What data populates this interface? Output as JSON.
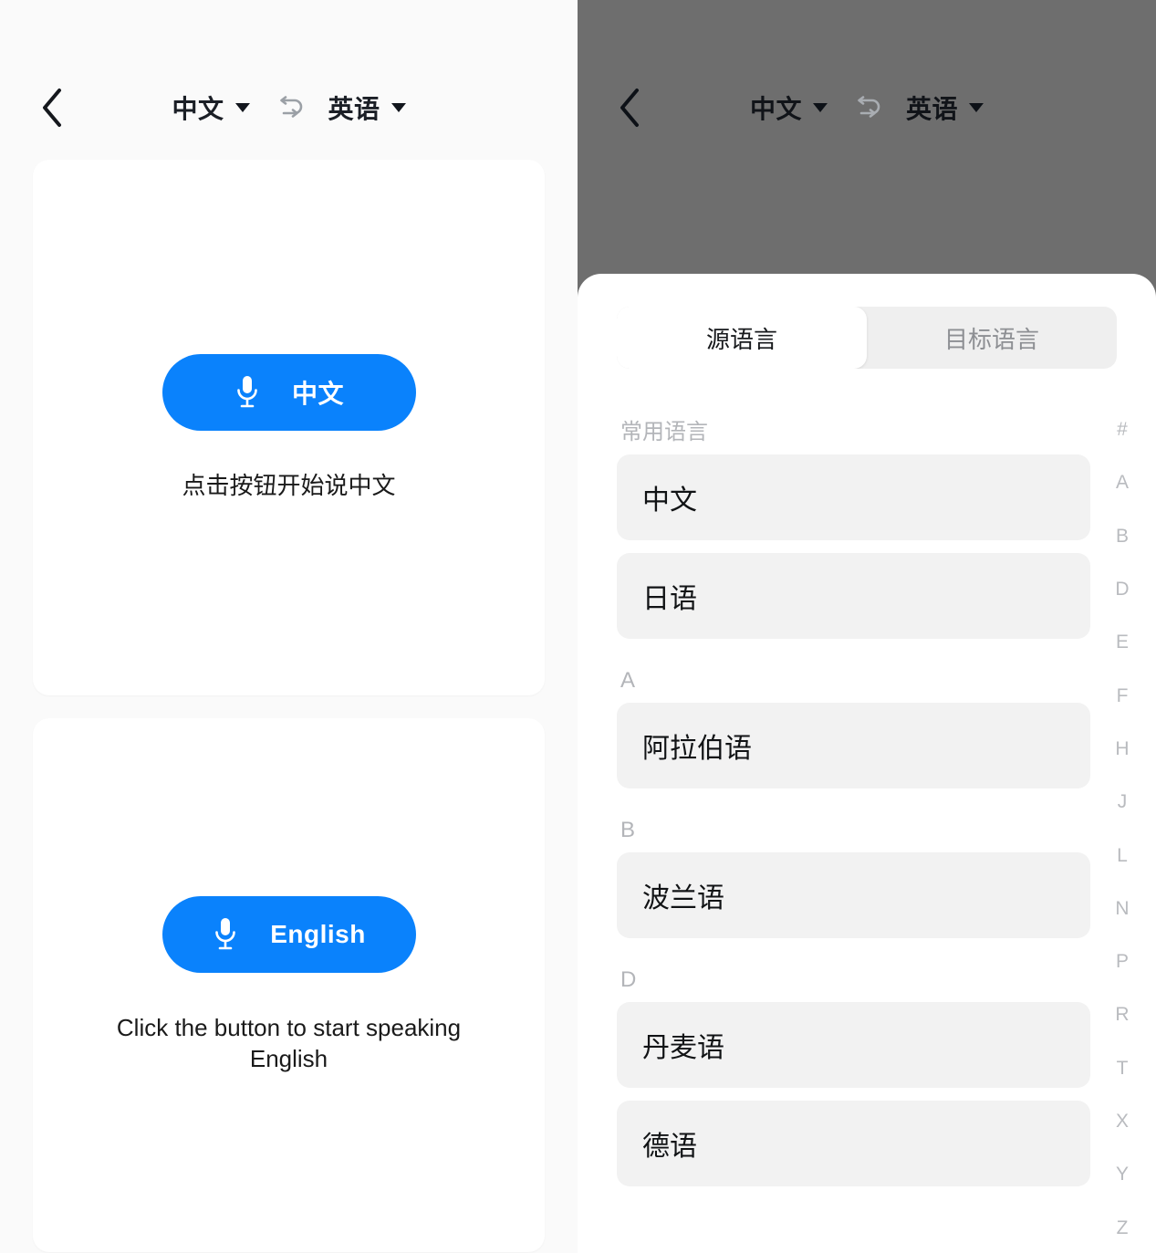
{
  "left_screen": {
    "appbar": {
      "back_icon": "chevron-left-icon",
      "source_language": "中文",
      "swap_icon": "swap-languages-icon",
      "target_language": "英语"
    },
    "cards": [
      {
        "mic_icon": "microphone-icon",
        "button_label": "中文",
        "hint": "点击按钮开始说中文"
      },
      {
        "mic_icon": "microphone-icon",
        "button_label": "English",
        "hint": "Click the button to start speaking English"
      }
    ],
    "accent_color": "#0A82FC",
    "card_background": "#FFFFFF",
    "page_background": "#FAFAFA"
  },
  "right_screen": {
    "appbar": {
      "back_icon": "chevron-left-icon",
      "source_language": "中文",
      "swap_icon": "swap-languages-icon",
      "target_language": "英语"
    },
    "scrim_color": "#6E6E6E",
    "sheet": {
      "tabs": [
        {
          "label": "源语言",
          "active": true
        },
        {
          "label": "目标语言",
          "active": false
        }
      ],
      "sections": [
        {
          "header": "常用语言",
          "items": [
            "中文",
            "日语"
          ]
        },
        {
          "header": "A",
          "items": [
            "阿拉伯语"
          ]
        },
        {
          "header": "B",
          "items": [
            "波兰语"
          ]
        },
        {
          "header": "D",
          "items": [
            "丹麦语",
            "德语"
          ]
        }
      ],
      "index_letters": [
        "#",
        "A",
        "B",
        "D",
        "E",
        "F",
        "H",
        "J",
        "L",
        "N",
        "P",
        "R",
        "T",
        "X",
        "Y",
        "Z"
      ],
      "row_background": "#F2F2F2",
      "tab_track_background": "#EFEFEF"
    }
  }
}
